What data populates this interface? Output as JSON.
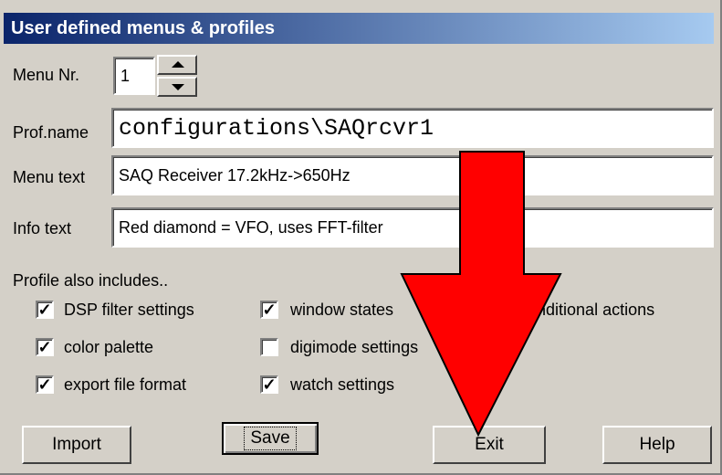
{
  "window": {
    "title": "User defined menus & profiles"
  },
  "menu_nr": {
    "label": "Menu Nr.",
    "value": "1"
  },
  "prof_name": {
    "label": "Prof.name",
    "value": "configurations\\SAQrcvr1"
  },
  "menu_text": {
    "label": "Menu text",
    "value": "SAQ Receiver 17.2kHz->650Hz"
  },
  "info_text": {
    "label": "Info text",
    "value": "Red diamond = VFO, uses FFT-filter"
  },
  "includes": {
    "heading": "Profile also  includes..",
    "options": [
      {
        "label": "DSP filter settings",
        "checked": true,
        "mark": "✓"
      },
      {
        "label": "window states",
        "checked": true,
        "mark": "✓"
      },
      {
        "label": "onditional actions",
        "checked": false,
        "mark": ""
      },
      {
        "label": "color palette",
        "checked": true,
        "mark": "✓"
      },
      {
        "label": "digimode settings",
        "checked": false,
        "mark": ""
      },
      {
        "label": "export file format",
        "checked": true,
        "mark": "✓"
      },
      {
        "label": "watch settings",
        "checked": true,
        "mark": "✓"
      }
    ]
  },
  "buttons": {
    "import": "Import",
    "save": "Save",
    "exit": "Exit",
    "help": "Help"
  },
  "annotation": {
    "arrow_color": "#ff0000",
    "outline_color": "#000000"
  }
}
